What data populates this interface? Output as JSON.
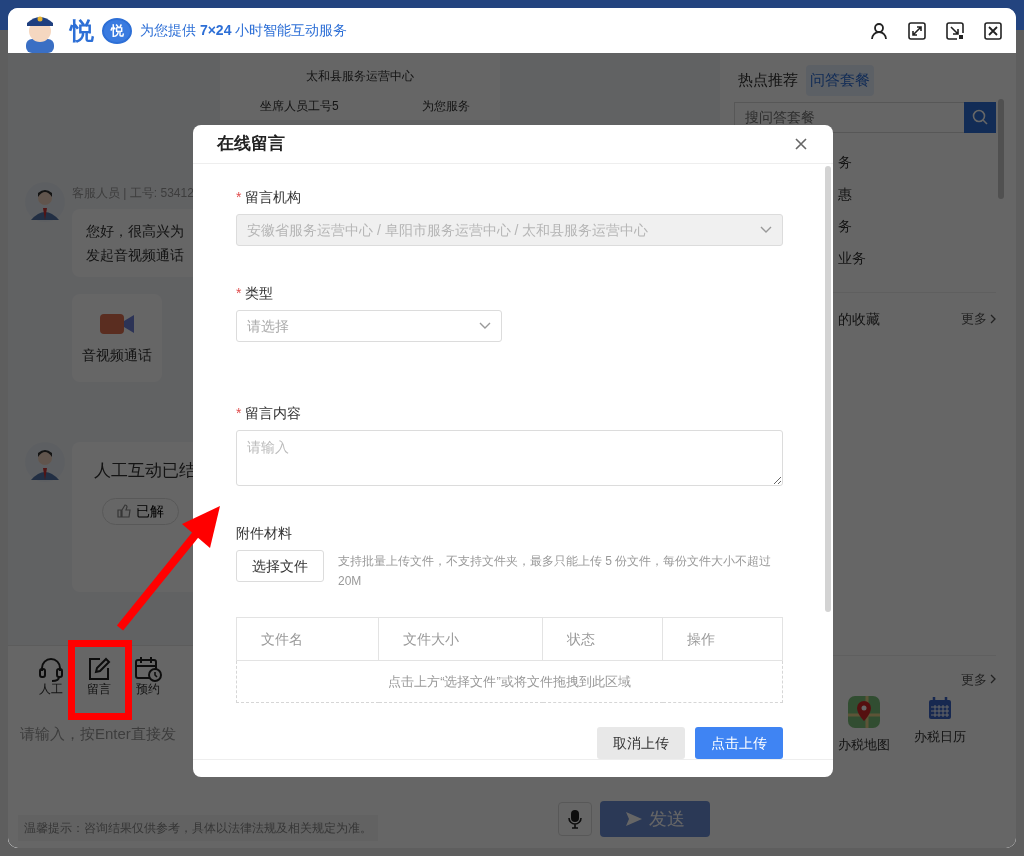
{
  "header": {
    "brand": "悦",
    "badge": "悦",
    "slogan": "为您提供 **7×24** 小时智能互动服务"
  },
  "service_card": {
    "center": "太和县服务运营中心",
    "agent": "坐席人员工号5",
    "greeting": "为您服务"
  },
  "chat": {
    "messages": [
      {
        "kind": "text",
        "sender": "客服人员 | 工号: 53412",
        "lines": [
          "您好，很高兴为",
          "发起音视频通话"
        ],
        "actions": [
          "音视频通话"
        ]
      },
      {
        "kind": "status",
        "text": "人工互动已结",
        "feedback": "已解"
      }
    ]
  },
  "toolbar": [
    {
      "kind": "headset",
      "label": "人工"
    },
    {
      "kind": "note",
      "label": "留言"
    },
    {
      "kind": "calendar",
      "label": "预约"
    }
  ],
  "composer": {
    "placeholder": "请输入，按Enter直接发",
    "notice": "温馨提示：咨询结果仅供参考，具体以法律法规及相关规定为准。",
    "send": {
      "label": "发送",
      "disabled": true
    }
  },
  "side_panel": {
    "tabs": [
      {
        "label": "热点推荐",
        "selected": false
      },
      {
        "label": "问答套餐",
        "selected": true
      }
    ],
    "search": {
      "placeholder": "搜问答套餐"
    },
    "items": [
      "务",
      "惠",
      "务",
      "业务"
    ],
    "favorites": {
      "title": "的收藏",
      "more": "更多"
    },
    "tools": {
      "more": "更多",
      "items": [
        {
          "kind": "map",
          "label": "办税地图"
        },
        {
          "kind": "calendar",
          "label": "办税日历"
        }
      ]
    }
  },
  "dialog": {
    "title": "在线留言",
    "required_mark": "*",
    "fields": [
      {
        "kind": "select",
        "label": "留言机构",
        "required": true,
        "disabled": true,
        "value": "安徽省服务运营中心 / 阜阳市服务运营中心 / 太和县服务运营中心"
      },
      {
        "kind": "select",
        "label": "类型",
        "required": true,
        "disabled": false,
        "placeholder": "请选择"
      },
      {
        "kind": "textarea",
        "label": "留言内容",
        "required": true,
        "placeholder": "请输入"
      }
    ],
    "attachments": {
      "label": "附件材料",
      "button": "选择文件",
      "hint": "支持批量上传文件，不支持文件夹，最多只能上传 5 份文件，每份文件大小不超过 20M",
      "columns": [
        "文件名",
        "文件大小",
        "状态",
        "操作"
      ],
      "empty": "点击上方“选择文件”或将文件拖拽到此区域"
    },
    "buttons": [
      {
        "kind": "secondary",
        "label": "取消上传"
      },
      {
        "kind": "primary",
        "label": "点击上传"
      }
    ]
  }
}
